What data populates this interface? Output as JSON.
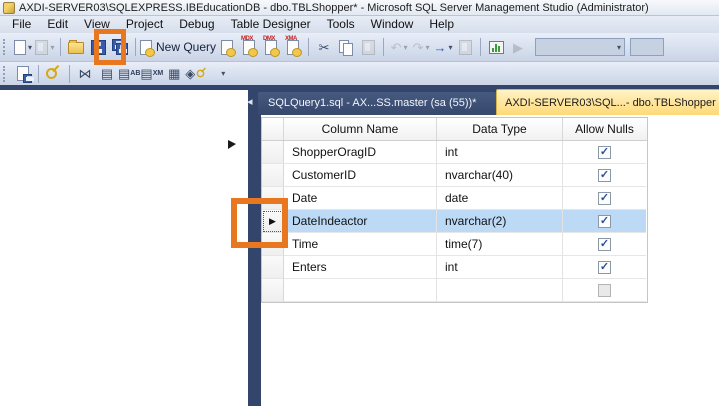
{
  "window": {
    "title": "AXDI-SERVER03\\SQLEXPRESS.IBEducationDB - dbo.TBLShopper* - Microsoft SQL Server Management Studio (Administrator)"
  },
  "menu": {
    "items": [
      "File",
      "Edit",
      "View",
      "Project",
      "Debug",
      "Table Designer",
      "Tools",
      "Window",
      "Help"
    ]
  },
  "toolbar": {
    "new_query_label": "New Query"
  },
  "icons": {
    "dropdown_arrow": "▾",
    "cut": "✂",
    "undo": "↶",
    "redo": "↷",
    "navigate": "→",
    "play": "▶",
    "overflow": "▾",
    "tab_scroll_left": "◂",
    "row_indicator": "▶",
    "check_mark": "✓",
    "relationships": "⋈",
    "indexes": "▤",
    "fulltext_label": "AB",
    "xml_label": "XM",
    "constraints": "▦",
    "spatial": "◈",
    "mdx_label": "MDX",
    "dmx_label": "DMX",
    "xmla_label": "XMA"
  },
  "tabs": [
    {
      "label": "SQLQuery1.sql - AX...SS.master (sa (55))*",
      "active": false
    },
    {
      "label": "AXDI-SERVER03\\SQL...- dbo.TBLShopper",
      "active": true
    }
  ],
  "grid": {
    "headers": [
      "Column Name",
      "Data Type",
      "Allow Nulls"
    ],
    "rows": [
      {
        "name": "ShopperOragID",
        "type": "int",
        "allow_nulls": true,
        "selected": false
      },
      {
        "name": "CustomerID",
        "type": "nvarchar(40)",
        "allow_nulls": true,
        "selected": false
      },
      {
        "name": "Date",
        "type": "date",
        "allow_nulls": true,
        "selected": false
      },
      {
        "name": "DateIndeactor",
        "type": "nvarchar(2)",
        "allow_nulls": true,
        "selected": true
      },
      {
        "name": "Time",
        "type": "time(7)",
        "allow_nulls": true,
        "selected": false
      },
      {
        "name": "Enters",
        "type": "int",
        "allow_nulls": true,
        "selected": false
      },
      {
        "name": "",
        "type": "",
        "allow_nulls": false,
        "selected": false
      }
    ]
  },
  "annotations": {
    "color": "#e8771f",
    "targets": [
      "save-button",
      "selected-row-indicator"
    ]
  }
}
